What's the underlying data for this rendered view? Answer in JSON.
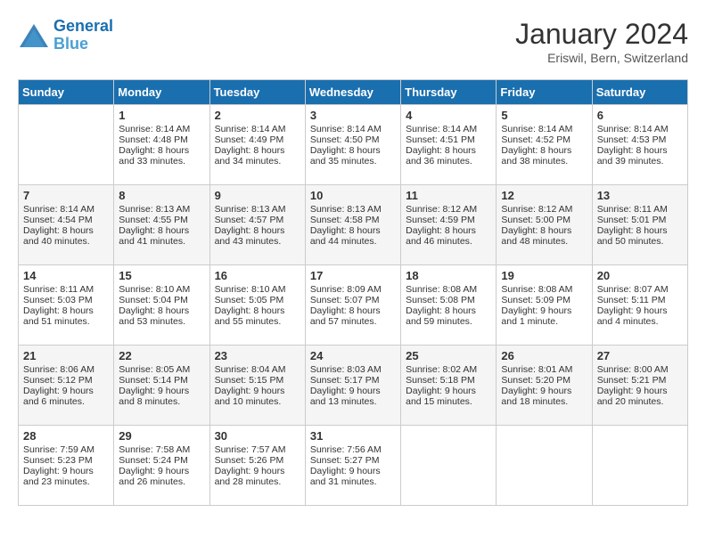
{
  "header": {
    "logo_line1": "General",
    "logo_line2": "Blue",
    "month": "January 2024",
    "location": "Eriswil, Bern, Switzerland"
  },
  "days_of_week": [
    "Sunday",
    "Monday",
    "Tuesday",
    "Wednesday",
    "Thursday",
    "Friday",
    "Saturday"
  ],
  "weeks": [
    [
      {
        "day": "",
        "empty": true
      },
      {
        "day": "1",
        "sunrise": "Sunrise: 8:14 AM",
        "sunset": "Sunset: 4:48 PM",
        "daylight": "Daylight: 8 hours and 33 minutes."
      },
      {
        "day": "2",
        "sunrise": "Sunrise: 8:14 AM",
        "sunset": "Sunset: 4:49 PM",
        "daylight": "Daylight: 8 hours and 34 minutes."
      },
      {
        "day": "3",
        "sunrise": "Sunrise: 8:14 AM",
        "sunset": "Sunset: 4:50 PM",
        "daylight": "Daylight: 8 hours and 35 minutes."
      },
      {
        "day": "4",
        "sunrise": "Sunrise: 8:14 AM",
        "sunset": "Sunset: 4:51 PM",
        "daylight": "Daylight: 8 hours and 36 minutes."
      },
      {
        "day": "5",
        "sunrise": "Sunrise: 8:14 AM",
        "sunset": "Sunset: 4:52 PM",
        "daylight": "Daylight: 8 hours and 38 minutes."
      },
      {
        "day": "6",
        "sunrise": "Sunrise: 8:14 AM",
        "sunset": "Sunset: 4:53 PM",
        "daylight": "Daylight: 8 hours and 39 minutes."
      }
    ],
    [
      {
        "day": "7",
        "sunrise": "Sunrise: 8:14 AM",
        "sunset": "Sunset: 4:54 PM",
        "daylight": "Daylight: 8 hours and 40 minutes."
      },
      {
        "day": "8",
        "sunrise": "Sunrise: 8:13 AM",
        "sunset": "Sunset: 4:55 PM",
        "daylight": "Daylight: 8 hours and 41 minutes."
      },
      {
        "day": "9",
        "sunrise": "Sunrise: 8:13 AM",
        "sunset": "Sunset: 4:57 PM",
        "daylight": "Daylight: 8 hours and 43 minutes."
      },
      {
        "day": "10",
        "sunrise": "Sunrise: 8:13 AM",
        "sunset": "Sunset: 4:58 PM",
        "daylight": "Daylight: 8 hours and 44 minutes."
      },
      {
        "day": "11",
        "sunrise": "Sunrise: 8:12 AM",
        "sunset": "Sunset: 4:59 PM",
        "daylight": "Daylight: 8 hours and 46 minutes."
      },
      {
        "day": "12",
        "sunrise": "Sunrise: 8:12 AM",
        "sunset": "Sunset: 5:00 PM",
        "daylight": "Daylight: 8 hours and 48 minutes."
      },
      {
        "day": "13",
        "sunrise": "Sunrise: 8:11 AM",
        "sunset": "Sunset: 5:01 PM",
        "daylight": "Daylight: 8 hours and 50 minutes."
      }
    ],
    [
      {
        "day": "14",
        "sunrise": "Sunrise: 8:11 AM",
        "sunset": "Sunset: 5:03 PM",
        "daylight": "Daylight: 8 hours and 51 minutes."
      },
      {
        "day": "15",
        "sunrise": "Sunrise: 8:10 AM",
        "sunset": "Sunset: 5:04 PM",
        "daylight": "Daylight: 8 hours and 53 minutes."
      },
      {
        "day": "16",
        "sunrise": "Sunrise: 8:10 AM",
        "sunset": "Sunset: 5:05 PM",
        "daylight": "Daylight: 8 hours and 55 minutes."
      },
      {
        "day": "17",
        "sunrise": "Sunrise: 8:09 AM",
        "sunset": "Sunset: 5:07 PM",
        "daylight": "Daylight: 8 hours and 57 minutes."
      },
      {
        "day": "18",
        "sunrise": "Sunrise: 8:08 AM",
        "sunset": "Sunset: 5:08 PM",
        "daylight": "Daylight: 8 hours and 59 minutes."
      },
      {
        "day": "19",
        "sunrise": "Sunrise: 8:08 AM",
        "sunset": "Sunset: 5:09 PM",
        "daylight": "Daylight: 9 hours and 1 minute."
      },
      {
        "day": "20",
        "sunrise": "Sunrise: 8:07 AM",
        "sunset": "Sunset: 5:11 PM",
        "daylight": "Daylight: 9 hours and 4 minutes."
      }
    ],
    [
      {
        "day": "21",
        "sunrise": "Sunrise: 8:06 AM",
        "sunset": "Sunset: 5:12 PM",
        "daylight": "Daylight: 9 hours and 6 minutes."
      },
      {
        "day": "22",
        "sunrise": "Sunrise: 8:05 AM",
        "sunset": "Sunset: 5:14 PM",
        "daylight": "Daylight: 9 hours and 8 minutes."
      },
      {
        "day": "23",
        "sunrise": "Sunrise: 8:04 AM",
        "sunset": "Sunset: 5:15 PM",
        "daylight": "Daylight: 9 hours and 10 minutes."
      },
      {
        "day": "24",
        "sunrise": "Sunrise: 8:03 AM",
        "sunset": "Sunset: 5:17 PM",
        "daylight": "Daylight: 9 hours and 13 minutes."
      },
      {
        "day": "25",
        "sunrise": "Sunrise: 8:02 AM",
        "sunset": "Sunset: 5:18 PM",
        "daylight": "Daylight: 9 hours and 15 minutes."
      },
      {
        "day": "26",
        "sunrise": "Sunrise: 8:01 AM",
        "sunset": "Sunset: 5:20 PM",
        "daylight": "Daylight: 9 hours and 18 minutes."
      },
      {
        "day": "27",
        "sunrise": "Sunrise: 8:00 AM",
        "sunset": "Sunset: 5:21 PM",
        "daylight": "Daylight: 9 hours and 20 minutes."
      }
    ],
    [
      {
        "day": "28",
        "sunrise": "Sunrise: 7:59 AM",
        "sunset": "Sunset: 5:23 PM",
        "daylight": "Daylight: 9 hours and 23 minutes."
      },
      {
        "day": "29",
        "sunrise": "Sunrise: 7:58 AM",
        "sunset": "Sunset: 5:24 PM",
        "daylight": "Daylight: 9 hours and 26 minutes."
      },
      {
        "day": "30",
        "sunrise": "Sunrise: 7:57 AM",
        "sunset": "Sunset: 5:26 PM",
        "daylight": "Daylight: 9 hours and 28 minutes."
      },
      {
        "day": "31",
        "sunrise": "Sunrise: 7:56 AM",
        "sunset": "Sunset: 5:27 PM",
        "daylight": "Daylight: 9 hours and 31 minutes."
      },
      {
        "day": "",
        "empty": true
      },
      {
        "day": "",
        "empty": true
      },
      {
        "day": "",
        "empty": true
      }
    ]
  ]
}
